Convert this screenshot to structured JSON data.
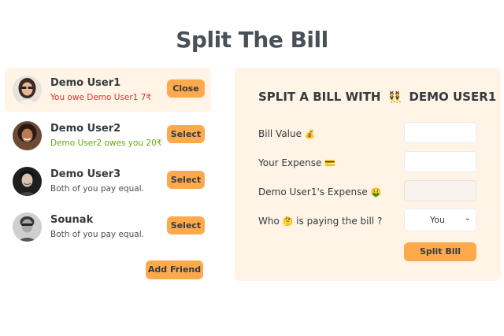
{
  "app": {
    "title": "Split The Bill"
  },
  "friends": [
    {
      "name": "Demo User1",
      "status": "You owe Demo User1 7₹",
      "status_type": "red",
      "button": "Close",
      "selected": true
    },
    {
      "name": "Demo User2",
      "status": "Demo User2 owes you 20₹",
      "status_type": "green",
      "button": "Select",
      "selected": false
    },
    {
      "name": "Demo User3",
      "status": "Both of you pay equal.",
      "status_type": "neutral",
      "button": "Select",
      "selected": false
    },
    {
      "name": "Sounak",
      "status": "Both of you pay equal.",
      "status_type": "neutral",
      "button": "Select",
      "selected": false
    }
  ],
  "add_friend_label": "Add Friend",
  "form": {
    "title": "SPLIT A BILL WITH",
    "title_icon": "👯",
    "title_name": "DEMO USER1",
    "bill_value_label": "Bill Value",
    "bill_value_icon": "💰",
    "your_expense_label": "Your Expense",
    "your_expense_icon": "💳",
    "friend_expense_label": "Demo User1's Expense",
    "friend_expense_icon": "🤑",
    "payer_label_before": "Who",
    "payer_icon": "🤔",
    "payer_label_after": "is paying the bill ?",
    "payer_value": "You",
    "submit_label": "Split Bill",
    "bill_value": "",
    "your_expense": "",
    "friend_expense": ""
  },
  "colors": {
    "accent": "#ffa94d",
    "panel": "#fff4e6",
    "owe": "#e03131",
    "owed": "#66a80f"
  }
}
